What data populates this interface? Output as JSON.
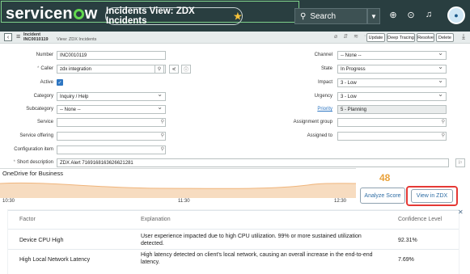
{
  "topbar": {
    "logo": "servicenow",
    "view_title": "Incidents View: ZDX Incidents",
    "search_placeholder": "Search"
  },
  "form_header": {
    "record_type": "Incident",
    "number": "INC0010119",
    "view_label": "View: ZDX Incidents",
    "buttons": [
      "Update",
      "Deep Tracing",
      "Resolve",
      "Delete"
    ]
  },
  "fields": {
    "number": {
      "label": "Number",
      "value": "INC0010119"
    },
    "caller": {
      "label": "Caller",
      "value": "zdx integration"
    },
    "active": {
      "label": "Active"
    },
    "category": {
      "label": "Category",
      "value": "Inquiry / Help"
    },
    "subcategory": {
      "label": "Subcategory",
      "value": "-- None --"
    },
    "service": {
      "label": "Service",
      "value": ""
    },
    "service_offering": {
      "label": "Service offering",
      "value": ""
    },
    "configuration_item": {
      "label": "Configuration item",
      "value": ""
    },
    "short_description": {
      "label": "Short description",
      "value": "ZDX Alert 7169168163626621281"
    },
    "channel": {
      "label": "Channel",
      "value": "-- None --"
    },
    "state": {
      "label": "State",
      "value": "In Progress"
    },
    "impact": {
      "label": "Impact",
      "value": "3 - Low"
    },
    "urgency": {
      "label": "Urgency",
      "value": "3 - Low"
    },
    "priority": {
      "label": "Priority",
      "value": "5 - Planning"
    },
    "assignment_group": {
      "label": "Assignment group",
      "value": ""
    },
    "assigned_to": {
      "label": "Assigned to",
      "value": ""
    }
  },
  "zdx": {
    "app_name": "OneDrive for Business",
    "timeline_labels": [
      "10:30",
      "11:30",
      "12:30"
    ],
    "score": "48",
    "analyze_label": "Analyze Score",
    "view_label": "View in ZDX"
  },
  "table": {
    "headers": [
      "Factor",
      "Explanation",
      "Confidence Level"
    ],
    "rows": [
      {
        "factor": "Device CPU High",
        "explanation": "User experience impacted due to high CPU utilization. 99% or more sustained utilization detected.",
        "confidence": "92.31%"
      },
      {
        "factor": "High Local Network Latency",
        "explanation": "High latency detected on client's local network, causing an overall increase in the end-to-end latency.",
        "confidence": "7.69%"
      }
    ]
  },
  "colors": {
    "topbar": "#293e40",
    "accent_green": "#62d84e",
    "score_orange": "#e9a23b",
    "highlight_red": "#e53935",
    "link_blue": "#2e76c2"
  }
}
